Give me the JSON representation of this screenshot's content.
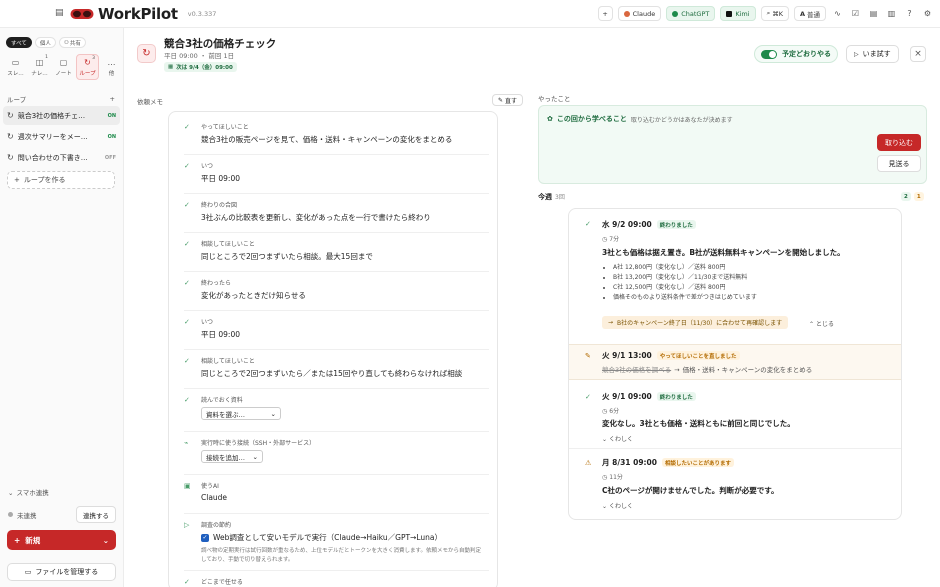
{
  "app": {
    "name": "WorkPilot",
    "version": "v0.3.337"
  },
  "topbar": {
    "models": [
      {
        "label": "Claude",
        "color": "#d9673f",
        "selected": false
      },
      {
        "label": "ChatGPT",
        "color": "#1d8a4a",
        "selected": true
      },
      {
        "label": "Kimi",
        "color": "#111111",
        "selected": true
      }
    ],
    "search_shortcut": "⌘K",
    "text_size": "普通"
  },
  "sidebar": {
    "filters": [
      "すべて",
      "個人",
      "共有"
    ],
    "modes": [
      {
        "label": "スレ…",
        "count": ""
      },
      {
        "label": "ナレ…",
        "count": "1"
      },
      {
        "label": "ノート",
        "count": ""
      },
      {
        "label": "ループ",
        "count": "3"
      },
      {
        "label": "他",
        "count": ""
      }
    ],
    "section": "ループ",
    "loops": [
      {
        "label": "競合3社の価格チェ…",
        "status": "ON"
      },
      {
        "label": "週次サマリーをメー…",
        "status": "ON"
      },
      {
        "label": "問い合わせの下書き…",
        "status": "OFF"
      }
    ],
    "make_loop": "ループを作る",
    "smartphone": {
      "heading": "スマホ連携",
      "status": "未連携",
      "button": "連携する"
    },
    "new_button": "新規",
    "files_button": "ファイルを管理する"
  },
  "header": {
    "title": "競合3社の価格チェック",
    "subtitle": "平日 09:00 ・ 前回 1日",
    "next_run": "次は 9/4（金）09:00",
    "schedule_label": "予定どおりやる",
    "try_label": "いま試す"
  },
  "memo": {
    "label": "依頼メモ",
    "edit_label": "直す",
    "fields": [
      {
        "label": "やってほしいこと",
        "value": "競合3社の販売ページを見て、価格・送料・キャンペーンの変化をまとめる"
      },
      {
        "label": "いつ",
        "value": "平日 09:00"
      },
      {
        "label": "終わりの合図",
        "value": "3社ぶんの比較表を更新し、変化があった点を一行で書けたら終わり"
      },
      {
        "label": "相談してほしいこと",
        "value": "同じところで2回つまずいたら相談。最大15回まで"
      },
      {
        "label": "終わったら",
        "value": "変化があったときだけ知らせる"
      },
      {
        "label": "いつ",
        "value": "平日 09:00"
      },
      {
        "label": "相談してほしいこと",
        "value": "同じところで2回つまずいたら／または15回やり直しても終わらなければ相談"
      },
      {
        "label": "読んでおく資料",
        "select": "資料を選ぶ…"
      },
      {
        "label": "実行時に使う接続（SSH・外部サービス）",
        "select": "接続を追加…"
      },
      {
        "label": "使うAI",
        "value": "Claude"
      },
      {
        "label": "調査の節約",
        "checkbox": "Web調査として安いモデルで実行（Claude→Haiku／GPT→Luna）",
        "note": "調べ物の定期実行は試行回数が重なるため、上位モデルだとトークンを大きく消費します。依頼メモから自動判定しており、手動で切り替えられます。"
      },
      {
        "label": "どこまで任せる"
      }
    ]
  },
  "done": {
    "label": "やったこと",
    "learn_title": "この回から学べること",
    "learn_sub": "取り込むかどうかはあなたが決めます",
    "take_button": "取り込む",
    "skip_button": "見送る",
    "week_label": "今週",
    "week_count": "3回",
    "counts": [
      "2",
      "1"
    ]
  },
  "timeline": [
    {
      "date": "水 9/2 09:00",
      "badge": "終わりました",
      "badge_type": "g",
      "duration": "7分",
      "summary": "3社とも価格は据え置き。B社が送料無料キャンペーンを開始しました。",
      "items": [
        "A社 12,800円（変化なし）／送料 800円",
        "B社 13,200円（変化なし）／11/30まで送料無料",
        "C社 12,500円（変化なし）／送料 800円",
        "価格そのものより送料条件で差がつきはじめています"
      ],
      "note": "B社のキャンペーン終了日（11/30）に合わせて再確認します",
      "collapse": "とじる"
    },
    {
      "date": "火 9/1 13:00",
      "badge": "やってほしいことを直しました",
      "badge_type": "y",
      "strike_old": "競合3社の価格を調べる",
      "strike_new": "価格・送料・キャンペーンの変化をまとめる"
    },
    {
      "date": "火 9/1 09:00",
      "badge": "終わりました",
      "badge_type": "g",
      "duration": "6分",
      "summary": "変化なし。3社とも価格・送料ともに前回と同じでした。",
      "more": "くわしく"
    },
    {
      "date": "月 8/31 09:00",
      "badge": "相談したいことがあります",
      "badge_type": "y",
      "duration": "11分",
      "summary": "C社のページが開けませんでした。判断が必要です。",
      "more": "くわしく"
    }
  ]
}
